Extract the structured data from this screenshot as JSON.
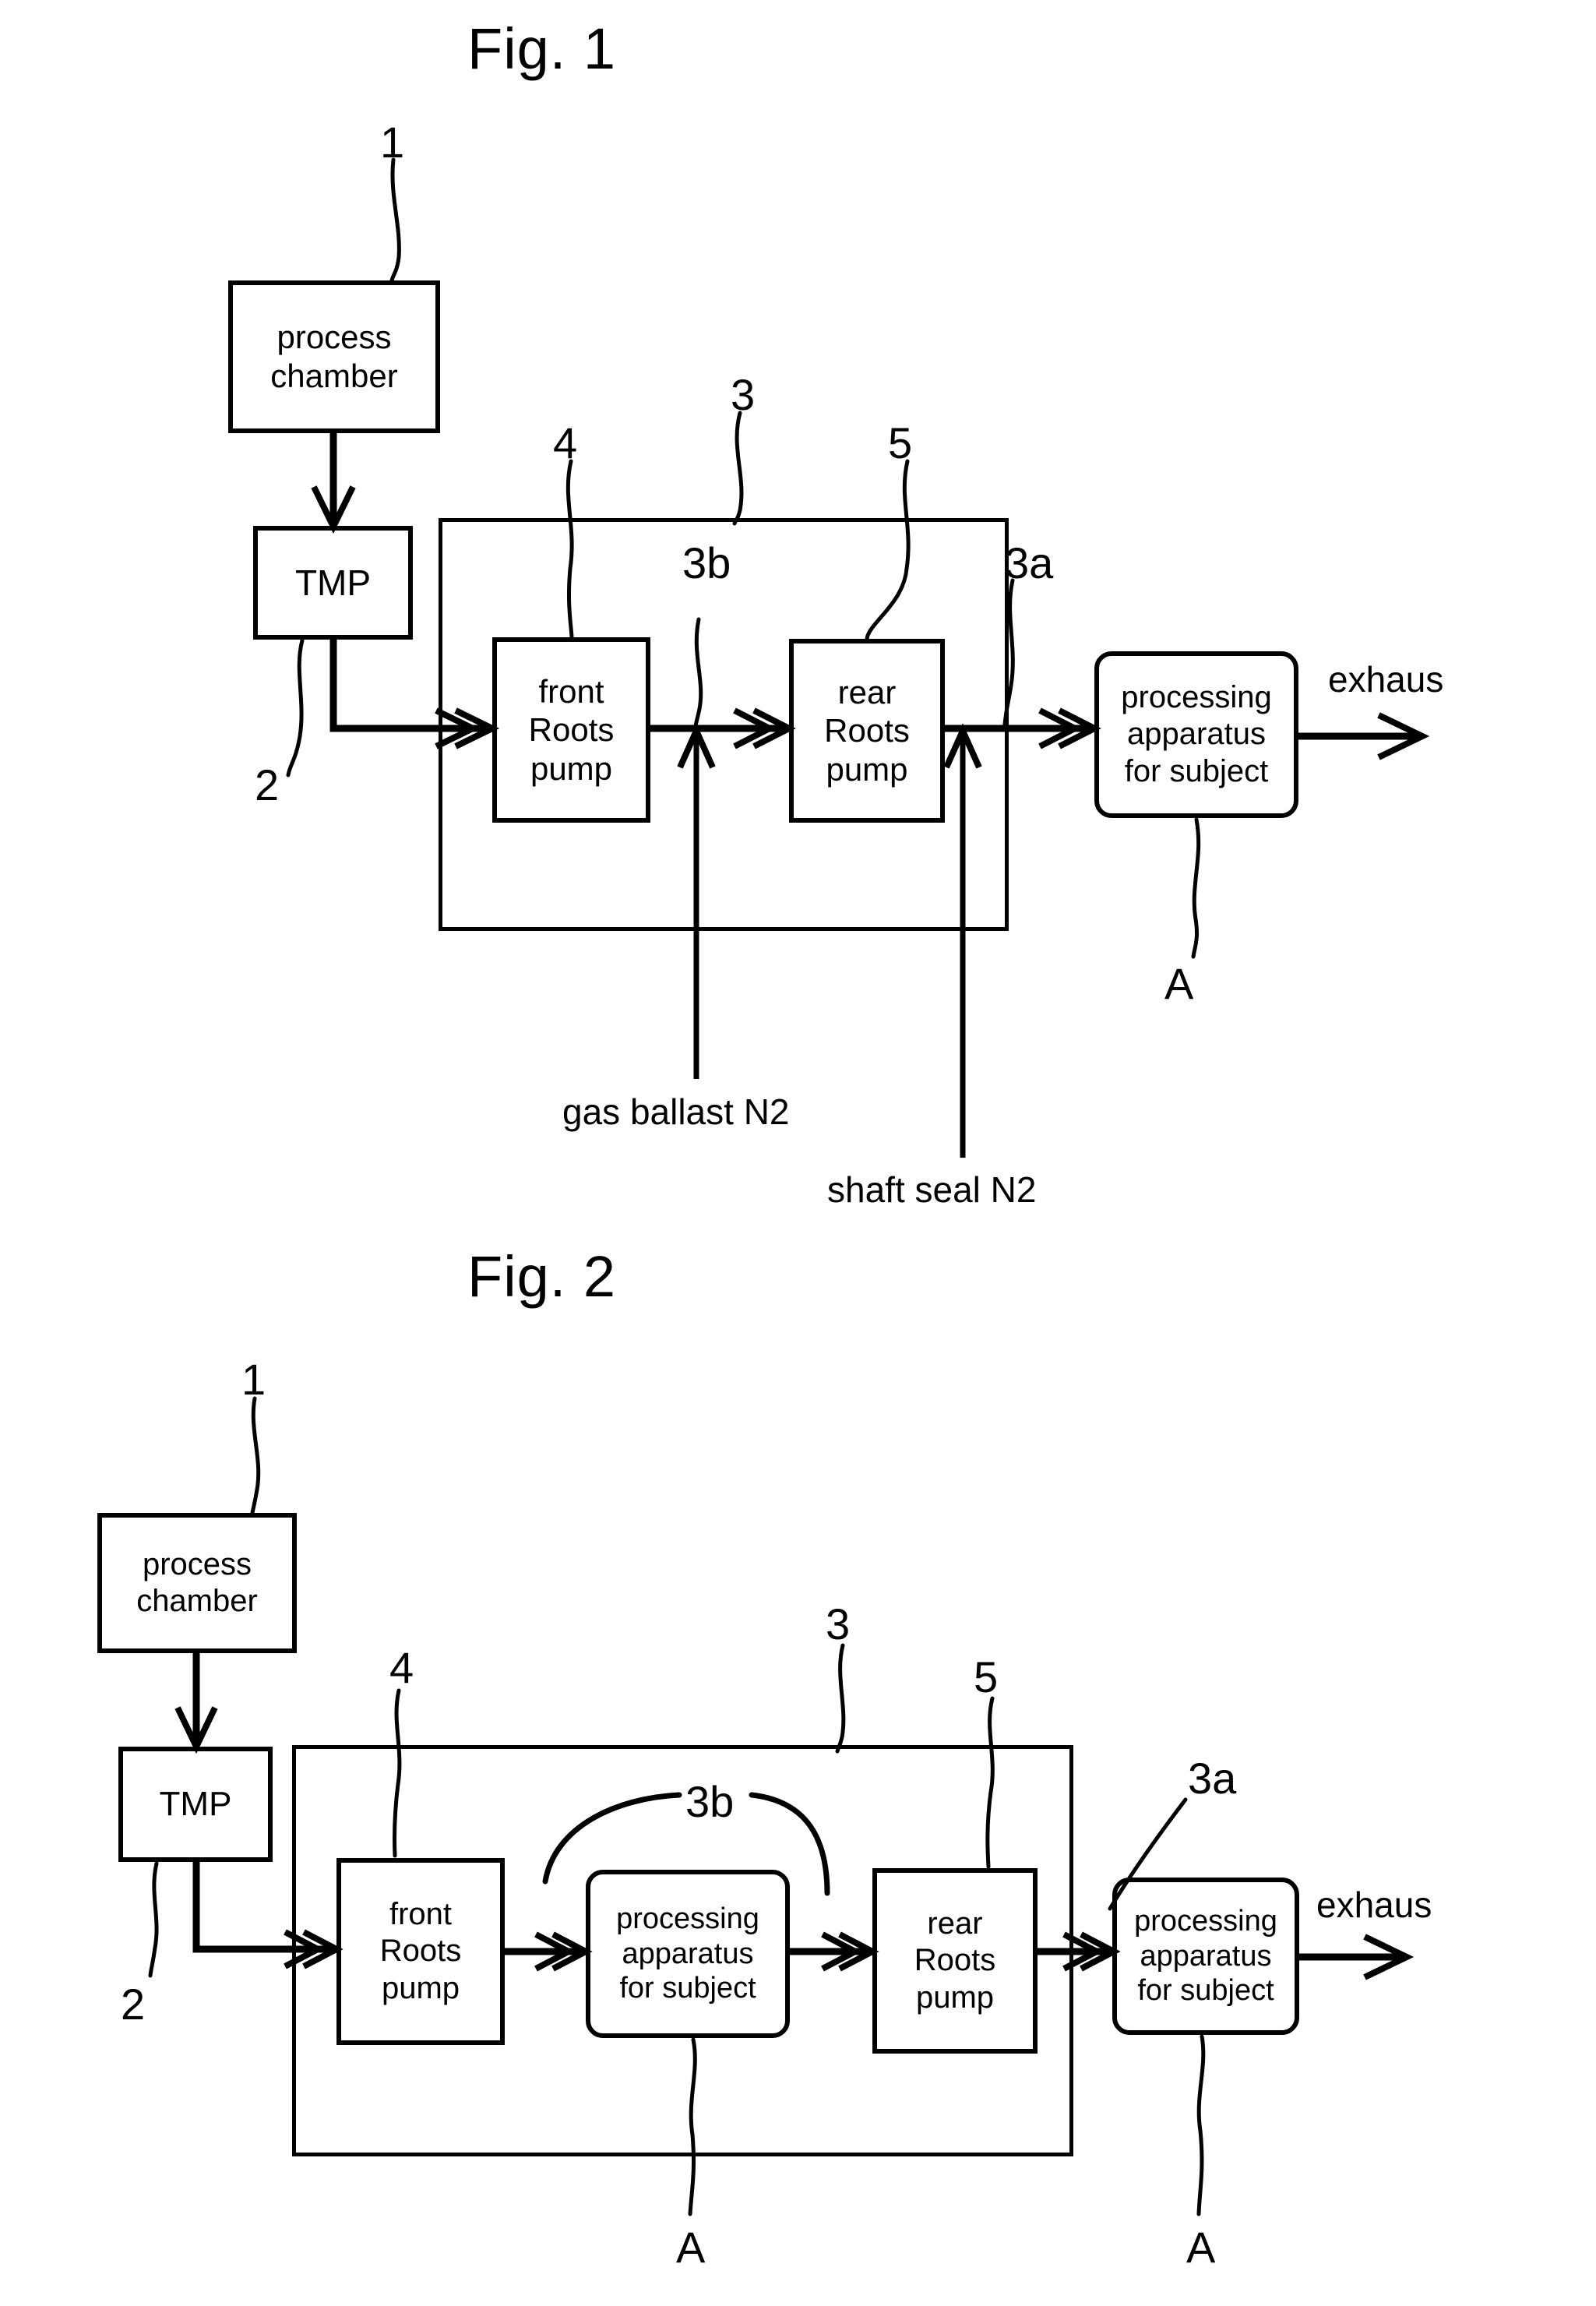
{
  "figures": [
    {
      "id": "fig1",
      "title": "Fig. 1",
      "blocks": {
        "process_chamber": {
          "line1": "process",
          "line2": "chamber"
        },
        "tmp": {
          "line1": "TMP"
        },
        "front_roots_pump": {
          "line1": "front",
          "line2": "Roots",
          "line3": "pump"
        },
        "rear_roots_pump": {
          "line1": "rear",
          "line2": "Roots",
          "line3": "pump"
        },
        "processing_apparatus": {
          "line1": "processing",
          "line2": "apparatus",
          "line3": "for subject"
        }
      },
      "labels": {
        "ref_1": "1",
        "ref_2": "2",
        "ref_3": "3",
        "ref_3a": "3a",
        "ref_3b": "3b",
        "ref_4": "4",
        "ref_5": "5",
        "ref_A": "A"
      },
      "captions": {
        "exhaust": "exhaus",
        "gas_ballast": "gas ballast N2",
        "shaft_seal": "shaft seal N2"
      }
    },
    {
      "id": "fig2",
      "title": "Fig. 2",
      "blocks": {
        "process_chamber": {
          "line1": "process",
          "line2": "chamber"
        },
        "tmp": {
          "line1": "TMP"
        },
        "front_roots_pump": {
          "line1": "front",
          "line2": "Roots",
          "line3": "pump"
        },
        "mid_processing_apparatus": {
          "line1": "processing",
          "line2": "apparatus",
          "line3": "for subject"
        },
        "rear_roots_pump": {
          "line1": "rear",
          "line2": "Roots",
          "line3": "pump"
        },
        "right_processing_apparatus": {
          "line1": "processing",
          "line2": "apparatus",
          "line3": "for subject"
        }
      },
      "labels": {
        "ref_1": "1",
        "ref_2": "2",
        "ref_3": "3",
        "ref_3a": "3a",
        "ref_3b": "3b",
        "ref_4": "4",
        "ref_5": "5",
        "ref_A_mid": "A",
        "ref_A_right": "A"
      },
      "captions": {
        "exhaust": "exhaus"
      }
    }
  ],
  "colors": {
    "ink": "#000000",
    "paper": "#ffffff"
  }
}
